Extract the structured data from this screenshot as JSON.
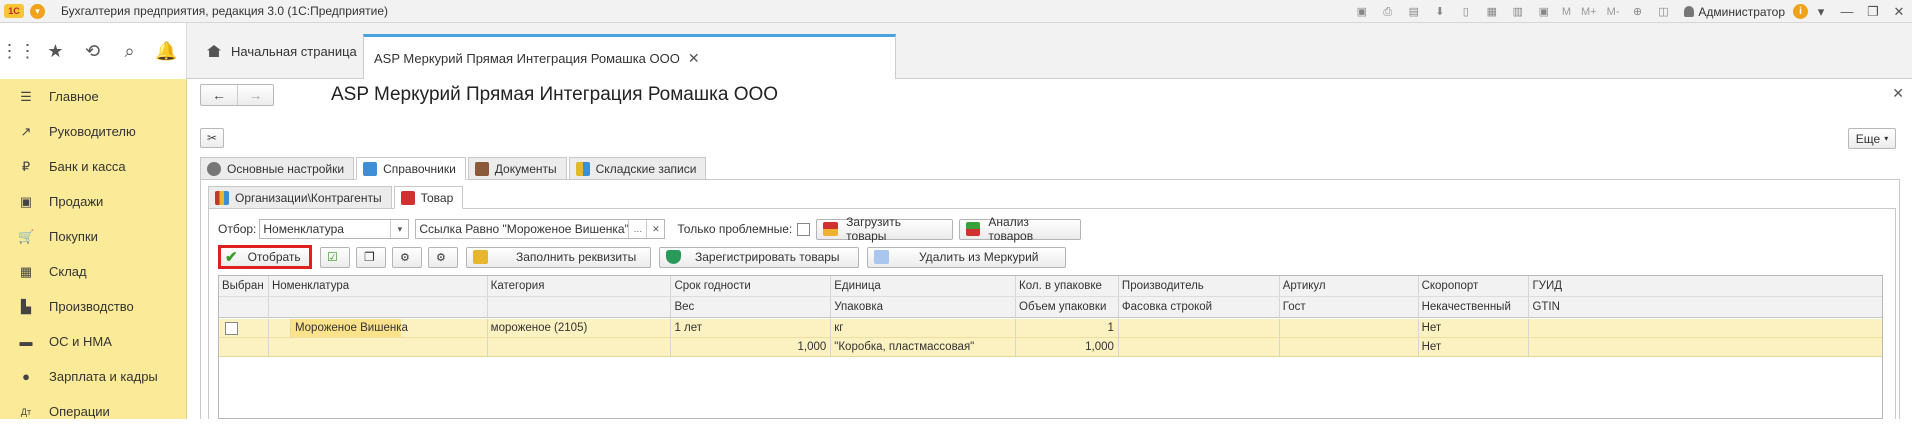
{
  "app": {
    "logo_text": "1С",
    "title": "Бухгалтерия предприятия, редакция 3.0  (1С:Предприятие)",
    "user": "Администратор",
    "toolbar_texts": [
      "M",
      "M+",
      "M-"
    ]
  },
  "nav": {
    "home_tab": "Начальная страница",
    "active_tab": "ASP Меркурий Прямая Интеграция Ромашка ООО",
    "close_glyph": "✕"
  },
  "sidebar": {
    "items": [
      {
        "label": "Главное",
        "icon": "menu-icon",
        "glyph": "☰"
      },
      {
        "label": "Руководителю",
        "icon": "trend-icon",
        "glyph": "↗"
      },
      {
        "label": "Банк и касса",
        "icon": "coin-icon",
        "glyph": "₽"
      },
      {
        "label": "Продажи",
        "icon": "bag-icon",
        "glyph": "▣"
      },
      {
        "label": "Покупки",
        "icon": "cart-icon",
        "glyph": "🛒"
      },
      {
        "label": "Склад",
        "icon": "grid-icon",
        "glyph": "▦"
      },
      {
        "label": "Производство",
        "icon": "factory-icon",
        "glyph": "▙"
      },
      {
        "label": "ОС и НМА",
        "icon": "truck-icon",
        "glyph": "▬"
      },
      {
        "label": "Зарплата и кадры",
        "icon": "person-icon",
        "glyph": "●"
      },
      {
        "label": "Операции",
        "icon": "operations-icon",
        "glyph": "Дт"
      }
    ]
  },
  "form": {
    "title": "ASP Меркурий Прямая Интеграция Ромашка ООО",
    "more_label": "Еще",
    "tabs": [
      "Основные настройки",
      "Справочники",
      "Документы",
      "Складские записи"
    ],
    "subtabs": [
      "Организации\\Контрагенты",
      "Товар"
    ],
    "filter": {
      "label": "Отбор:",
      "field_value": "Номенклатура",
      "condition_value": "Ссылка Равно \"Мороженое Вишенка\"",
      "problem_label": "Только проблемные:",
      "load_button": "Загрузить товары",
      "analyze_button": "Анализ товаров"
    },
    "commands": {
      "select_button": "Отобрать",
      "fill_button": "Заполнить реквизиты",
      "register_button": "Зарегистрировать товары",
      "delete_button": "Удалить из Меркурий"
    }
  },
  "table": {
    "header1": [
      "Выбран",
      "Номенклатура",
      "Категория",
      "Срок годности",
      "Единица",
      "Кол. в упаковке",
      "Производитель",
      "Артикул",
      "Скоропорт",
      "ГУИД"
    ],
    "header2": [
      "",
      "",
      "",
      "Вес",
      "Упаковка",
      "Объем упаковки",
      "Фасовка строкой",
      "Гост",
      "Некачественный",
      "GTIN"
    ],
    "row1": [
      "",
      "Мороженое Вишенка",
      "мороженое (2105)",
      "1 лет",
      "кг",
      "1",
      "",
      "",
      "Нет",
      ""
    ],
    "row2": [
      "",
      "",
      "",
      "1,000",
      "\"Коробка, пластмассовая\"",
      "1,000",
      "",
      "",
      "Нет",
      ""
    ]
  },
  "colors": {
    "sidebar": "#fbeb99",
    "accent": "#4aa3df",
    "highlight_row": "#fcf1c0",
    "select_outline": "#e02020"
  }
}
